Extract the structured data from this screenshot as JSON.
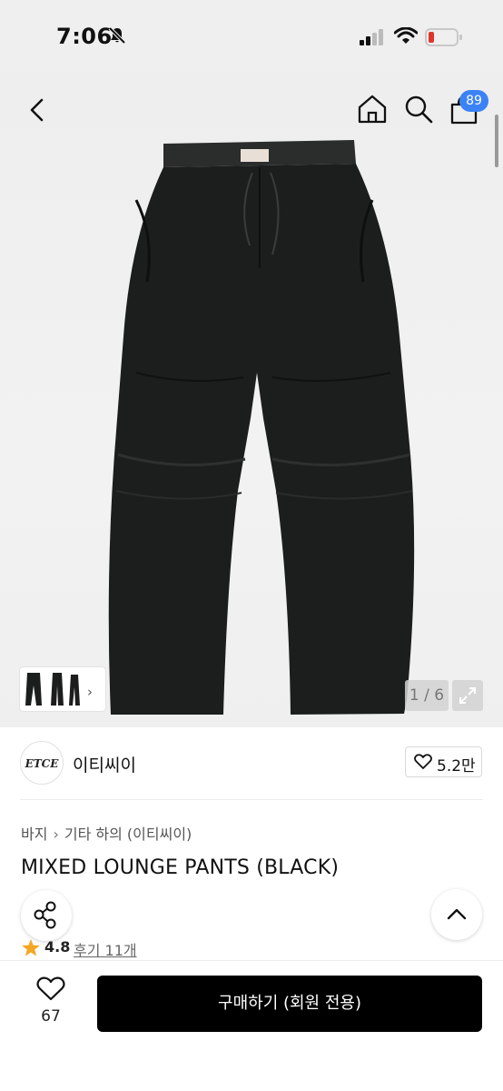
{
  "status_bar": {
    "time": "7:06"
  },
  "header": {
    "cart_count": "89"
  },
  "gallery": {
    "page_indicator": "1 / 6",
    "thumb_chevron": "›"
  },
  "brand": {
    "logo_text": "ETCE",
    "name": "이티씨이",
    "likes": "5.2만"
  },
  "breadcrumb": {
    "category": "바지",
    "subcategory": "기타 하의 (이티씨이)"
  },
  "product": {
    "title": "MIXED LOUNGE PANTS (BLACK)",
    "rating": "4.8",
    "review_link": "후기 11개"
  },
  "bottom_bar": {
    "wish_count": "67",
    "buy_label": "구매하기 (회원 전용)"
  },
  "colors": {
    "badge": "#3b82f6",
    "star": "#f5a623",
    "buy_button": "#000000"
  },
  "icons": [
    "bell-off-icon",
    "signal-icon",
    "wifi-icon",
    "battery-icon",
    "back-icon",
    "home-icon",
    "search-icon",
    "cart-icon",
    "chevron-right-icon",
    "expand-icon",
    "heart-icon",
    "share-icon",
    "chevron-up-icon",
    "star-icon"
  ]
}
